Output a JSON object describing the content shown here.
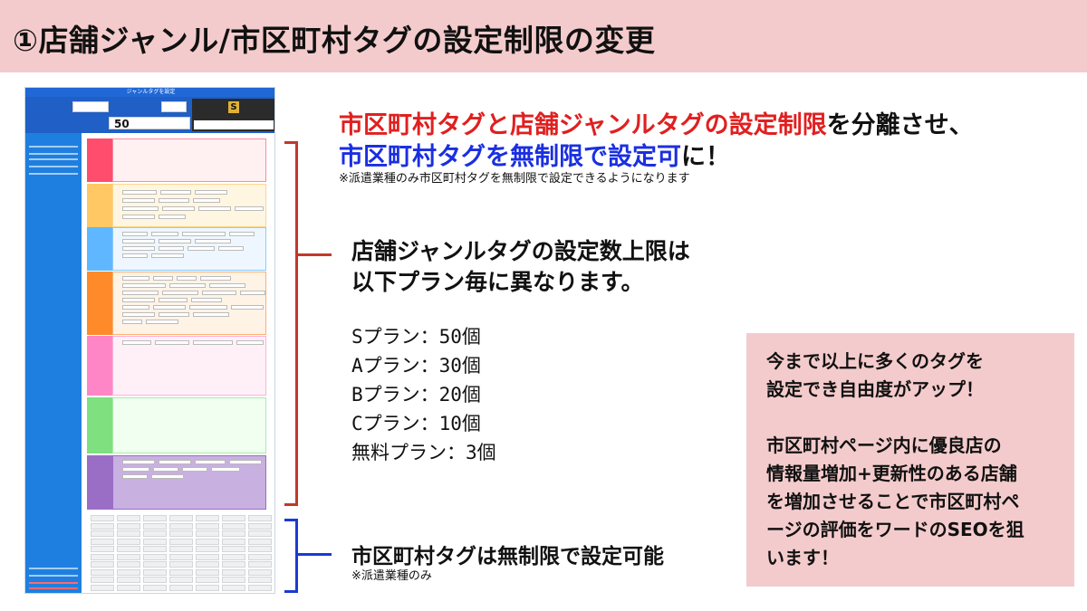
{
  "title": "①店舗ジャンル/市区町村タグの設定制限の変更",
  "screenshot": {
    "header": "ジャンルタグを設定",
    "plan_letter": "S",
    "tag_count": "50",
    "colors": {
      "header_blue": "#1f68d6",
      "side_blue": "#1f7fe0",
      "cat_red": "#ff4d6d",
      "cat_yellow": "#ffc864",
      "cat_blue": "#5fb8ff",
      "cat_orange": "#ff8a2a",
      "cat_pink": "#ff86c6",
      "cat_green": "#7ee07e",
      "cat_purple": "#9b6ec6"
    }
  },
  "headline": {
    "line1_red": "市区町村タグと店舗ジャンルタグの設定制限",
    "line1_black": "を分離させ、",
    "line2_blue": "市区町村タグを無制限で設定可",
    "line2_black": "に！",
    "note": "※派遣業種のみ市区町村タグを無制限で設定できるようになります"
  },
  "genre_limit": {
    "line1": "店舗ジャンルタグの設定数上限は",
    "line2": "以下プラン毎に異なります。"
  },
  "plans": [
    "Sプラン：50個",
    "Aプラン：30個",
    "Bプラン：20個",
    "Cプラン：10個",
    "無料プラン：3個"
  ],
  "city_unlimited": {
    "main": "市区町村タグは無制限で設定可能",
    "note": "※派遣業種のみ"
  },
  "benefit_box": {
    "text": "今まで以上に多くのタグを\n設定でき自由度がアップ！\n\n市区町村ページ内に優良店の\n情報量増加+更新性のある店舗\nを増加させることで市区町村ペ\nージの評価をワードのSEOを狙\nいます！"
  }
}
